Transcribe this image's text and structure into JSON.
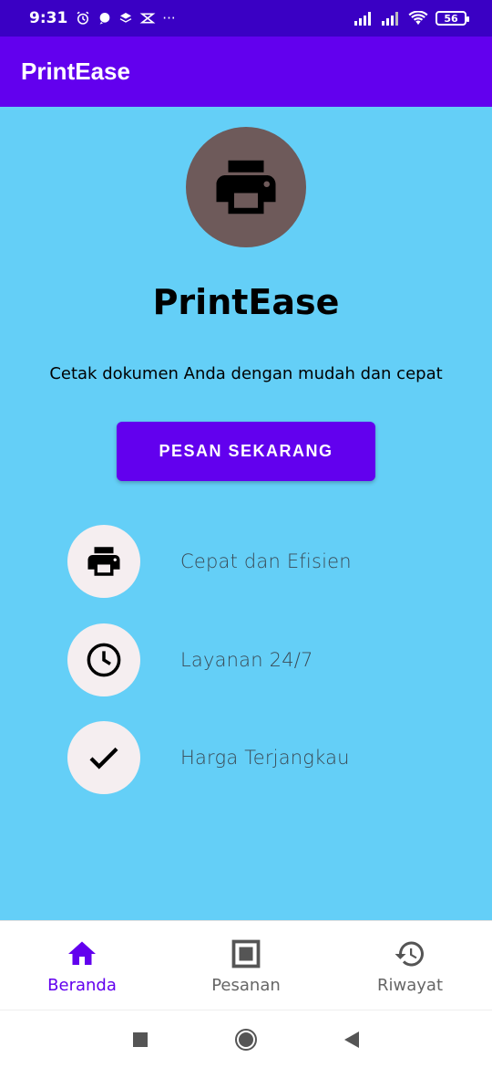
{
  "status_bar": {
    "time": "9:31",
    "more": "···",
    "battery": "56"
  },
  "app_bar": {
    "title": "PrintEase"
  },
  "hero": {
    "icon": "printer-icon",
    "title": "PrintEase",
    "subtitle": "Cetak dokumen Anda dengan mudah dan cepat",
    "cta_label": "PESAN SEKARANG"
  },
  "features": [
    {
      "icon": "printer-icon",
      "label": "Cepat dan Efisien"
    },
    {
      "icon": "clock-icon",
      "label": "Layanan 24/7"
    },
    {
      "icon": "check-icon",
      "label": "Harga Terjangkau"
    }
  ],
  "bottom_nav": [
    {
      "icon": "home-icon",
      "label": "Beranda",
      "active": true
    },
    {
      "icon": "orders-icon",
      "label": "Pesanan",
      "active": false
    },
    {
      "icon": "history-icon",
      "label": "Riwayat",
      "active": false
    }
  ],
  "colors": {
    "app_bar": "#6200ee",
    "status_bar": "#3a00c4",
    "background": "#64cff7",
    "accent": "#6200ee"
  }
}
